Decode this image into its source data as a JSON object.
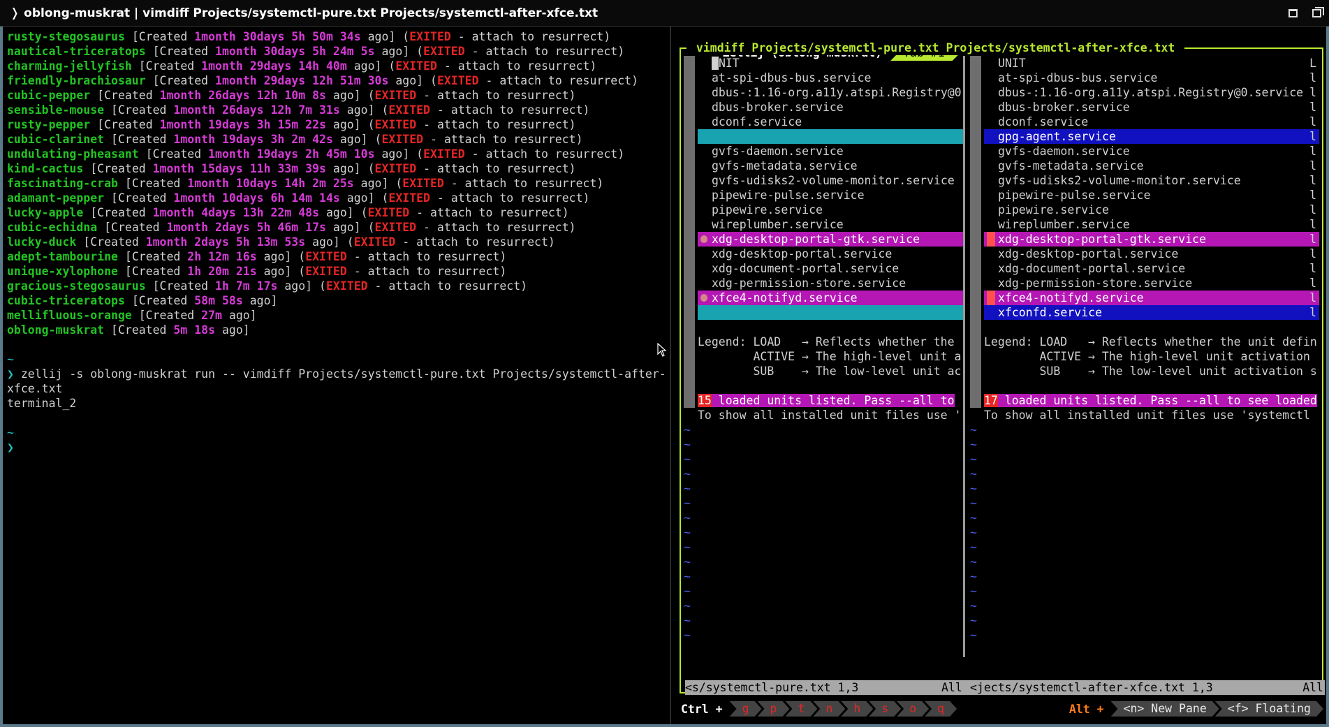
{
  "window": {
    "title": "❭ oblong-muskrat | vimdiff Projects/systemctl-pure.txt Projects/systemctl-after-xfce.txt"
  },
  "sessions": [
    {
      "name": "rusty-stegosaurus",
      "age": "1month 30days 5h 50m 34s",
      "exited": true
    },
    {
      "name": "nautical-triceratops",
      "age": "1month 30days 5h 24m 5s",
      "exited": true
    },
    {
      "name": "charming-jellyfish",
      "age": "1month 29days 14h 40m",
      "exited": true
    },
    {
      "name": "friendly-brachiosaur",
      "age": "1month 29days 12h 51m 30s",
      "exited": true
    },
    {
      "name": "cubic-pepper",
      "age": "1month 26days 12h 10m 8s",
      "exited": true
    },
    {
      "name": "sensible-mouse",
      "age": "1month 26days 12h 7m 31s",
      "exited": true
    },
    {
      "name": "rusty-pepper",
      "age": "1month 19days 3h 15m 22s",
      "exited": true
    },
    {
      "name": "cubic-clarinet",
      "age": "1month 19days 3h 2m 42s",
      "exited": true
    },
    {
      "name": "undulating-pheasant",
      "age": "1month 19days 2h 45m 10s",
      "exited": true
    },
    {
      "name": "kind-cactus",
      "age": "1month 15days 11h 33m 39s",
      "exited": true
    },
    {
      "name": "fascinating-crab",
      "age": "1month 10days 14h 2m 25s",
      "exited": true
    },
    {
      "name": "adamant-pepper",
      "age": "1month 10days 6h 14m 14s",
      "exited": true
    },
    {
      "name": "lucky-apple",
      "age": "1month 4days 13h 22m 48s",
      "exited": true
    },
    {
      "name": "cubic-echidna",
      "age": "1month 2days 5h 46m 17s",
      "exited": true
    },
    {
      "name": "lucky-duck",
      "age": "1month 2days 5h 13m 53s",
      "exited": true
    },
    {
      "name": "adept-tambourine",
      "age": "2h 12m 16s",
      "exited": true
    },
    {
      "name": "unique-xylophone",
      "age": "1h 20m 21s",
      "exited": true
    },
    {
      "name": "gracious-stegosaurus",
      "age": "1h 7m 17s",
      "exited": true
    },
    {
      "name": "cubic-triceratops",
      "age": "58m 58s",
      "exited": false
    },
    {
      "name": "mellifluous-orange",
      "age": "27m",
      "exited": false
    },
    {
      "name": "oblong-muskrat",
      "age": "5m 18s",
      "exited": false
    }
  ],
  "session_text": {
    "created": "[Created ",
    "ago": " ago]",
    "paren_open": " (",
    "exited": "EXITED",
    "attach": " - attach to resurrect)"
  },
  "shell": {
    "tilde": "~",
    "prompt": "❯",
    "command_line1": " zellij -s oblong-muskrat run -- vimdiff Projects/systemctl-pure.txt Projects/systemctl-after-",
    "command_line2": "xfce.txt",
    "output": "terminal_2"
  },
  "zellij": {
    "session_label": "Zellij (oblong-muskrat)",
    "tab_label": "Tab #1",
    "pane_title": " vimdiff Projects/systemctl-pure.txt Projects/systemctl-after-xfce.txt ",
    "ctrl_label": "Ctrl +",
    "ctrl_keys": [
      "g",
      "p",
      "t",
      "n",
      "h",
      "s",
      "o",
      "q"
    ],
    "alt_label": "Alt +",
    "alt_keys": [
      "<n> New Pane",
      "<f> Floating"
    ]
  },
  "vim_left": {
    "lines": [
      {
        "text": "NIT",
        "style": "cursor",
        "cursor_char": " "
      },
      {
        "text": "at-spi-dbus-bus.service"
      },
      {
        "text": "dbus-:1.16-org.a11y.atspi.Registry@0"
      },
      {
        "text": "dbus-broker.service"
      },
      {
        "text": "dconf.service"
      },
      {
        "text": "",
        "style": "cyan"
      },
      {
        "text": "gvfs-daemon.service"
      },
      {
        "text": "gvfs-metadata.service"
      },
      {
        "text": "gvfs-udisks2-volume-monitor.service"
      },
      {
        "text": "pipewire-pulse.service"
      },
      {
        "text": "pipewire.service"
      },
      {
        "text": "wireplumber.service"
      },
      {
        "text": "xdg-desktop-portal-gtk.service",
        "style": "mag",
        "sign": "dot"
      },
      {
        "text": "xdg-desktop-portal.service"
      },
      {
        "text": "xdg-document-portal.service"
      },
      {
        "text": "xdg-permission-store.service"
      },
      {
        "text": "xfce4-notifyd.service",
        "style": "mag",
        "sign": "dot"
      },
      {
        "text": "",
        "style": "cyan"
      },
      {
        "text": ""
      },
      {
        "text": "Legend: LOAD   → Reflects whether the",
        "nopad": true
      },
      {
        "text": "        ACTIVE → The high-level unit a",
        "nopad": true
      },
      {
        "text": "        SUB    → The low-level unit ac",
        "nopad": true
      },
      {
        "text": "",
        "nopad": true
      },
      {
        "text": " loaded units listed. Pass --all to",
        "nopad": true,
        "style": "mag",
        "num": "15"
      },
      {
        "text": "To show all installed unit files use '",
        "nopad": true
      }
    ],
    "status_file": "<s/systemctl-pure.txt 1,3",
    "status_pos": "All"
  },
  "vim_right": {
    "lines": [
      {
        "text": "UNIT",
        "right": "L"
      },
      {
        "text": "at-spi-dbus-bus.service",
        "right": "l"
      },
      {
        "text": "dbus-:1.16-org.a11y.atspi.Registry@0.service",
        "right": "l"
      },
      {
        "text": "dbus-broker.service",
        "right": "l"
      },
      {
        "text": "dconf.service",
        "right": "l"
      },
      {
        "text": "gpg-agent.service",
        "style": "blue",
        "right": "l"
      },
      {
        "text": "gvfs-daemon.service",
        "right": "l"
      },
      {
        "text": "gvfs-metadata.service",
        "right": "l"
      },
      {
        "text": "gvfs-udisks2-volume-monitor.service",
        "right": "l"
      },
      {
        "text": "pipewire-pulse.service",
        "right": "l"
      },
      {
        "text": "pipewire.service",
        "right": "l"
      },
      {
        "text": "wireplumber.service",
        "right": "l"
      },
      {
        "text": "xdg-desktop-portal-gtk.service",
        "style": "mag",
        "sign": "sq",
        "right": "l"
      },
      {
        "text": "xdg-desktop-portal.service",
        "right": "l"
      },
      {
        "text": "xdg-document-portal.service",
        "right": "l"
      },
      {
        "text": "xdg-permission-store.service",
        "right": "l"
      },
      {
        "text": "xfce4-notifyd.service",
        "style": "mag",
        "sign": "sq",
        "right": "l"
      },
      {
        "text": "xfconfd.service",
        "style": "blue",
        "right": "l"
      },
      {
        "text": ""
      },
      {
        "text": "Legend: LOAD   → Reflects whether the unit defin",
        "nopad": true
      },
      {
        "text": "        ACTIVE → The high-level unit activation",
        "nopad": true
      },
      {
        "text": "        SUB    → The low-level unit activation s",
        "nopad": true
      },
      {
        "text": "",
        "nopad": true
      },
      {
        "text": " loaded units listed. Pass --all to see loaded",
        "nopad": true,
        "style": "mag",
        "num": "17"
      },
      {
        "text": "To show all installed unit files use 'systemctl",
        "nopad": true
      }
    ],
    "status_file": "<jects/systemctl-after-xfce.txt 1,3",
    "status_pos": "All"
  },
  "vim_tilde": "~",
  "colors": {
    "accent": "#b8e830",
    "session_name": "#22c322",
    "age": "#d63ad6",
    "exited": "#e52525"
  }
}
